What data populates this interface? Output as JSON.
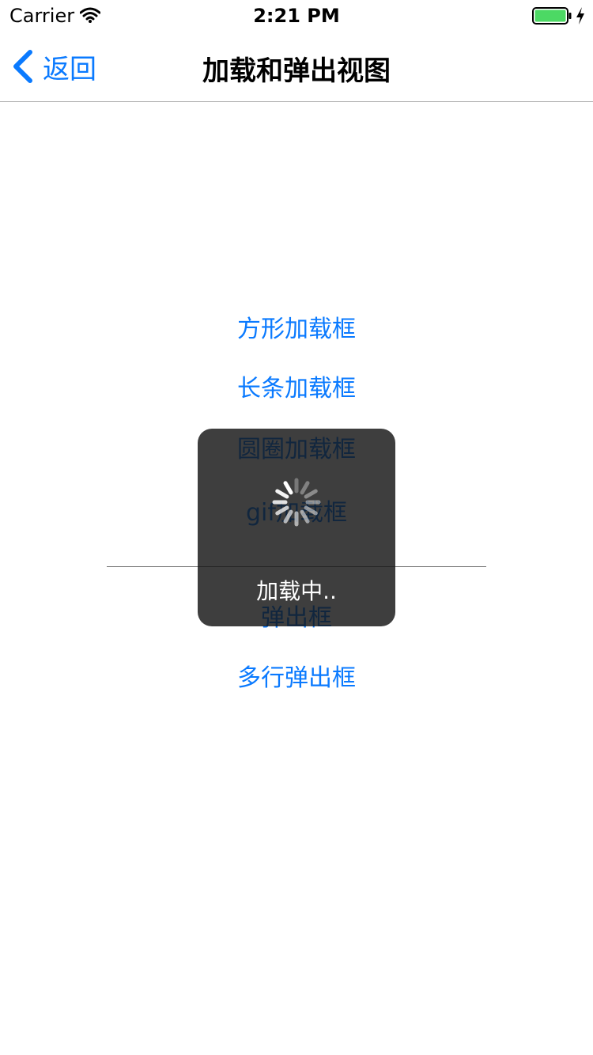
{
  "status_bar": {
    "carrier": "Carrier",
    "time": "2:21 PM",
    "icons": [
      "wifi-icon",
      "battery-icon",
      "charging-icon"
    ],
    "battery_color": "#4cd964"
  },
  "nav": {
    "back_label": "返回",
    "title": "加载和弹出视图",
    "tint_color": "#0a7aff"
  },
  "menu": {
    "items": [
      {
        "label": "方形加载框"
      },
      {
        "label": "长条加载框"
      },
      {
        "label": "圆圈加载框"
      },
      {
        "label": "gif加载框"
      },
      {
        "label": "弹出框"
      },
      {
        "label": "多行弹出框"
      }
    ]
  },
  "hud": {
    "label": "加载中..",
    "icon": "spinner-icon"
  }
}
